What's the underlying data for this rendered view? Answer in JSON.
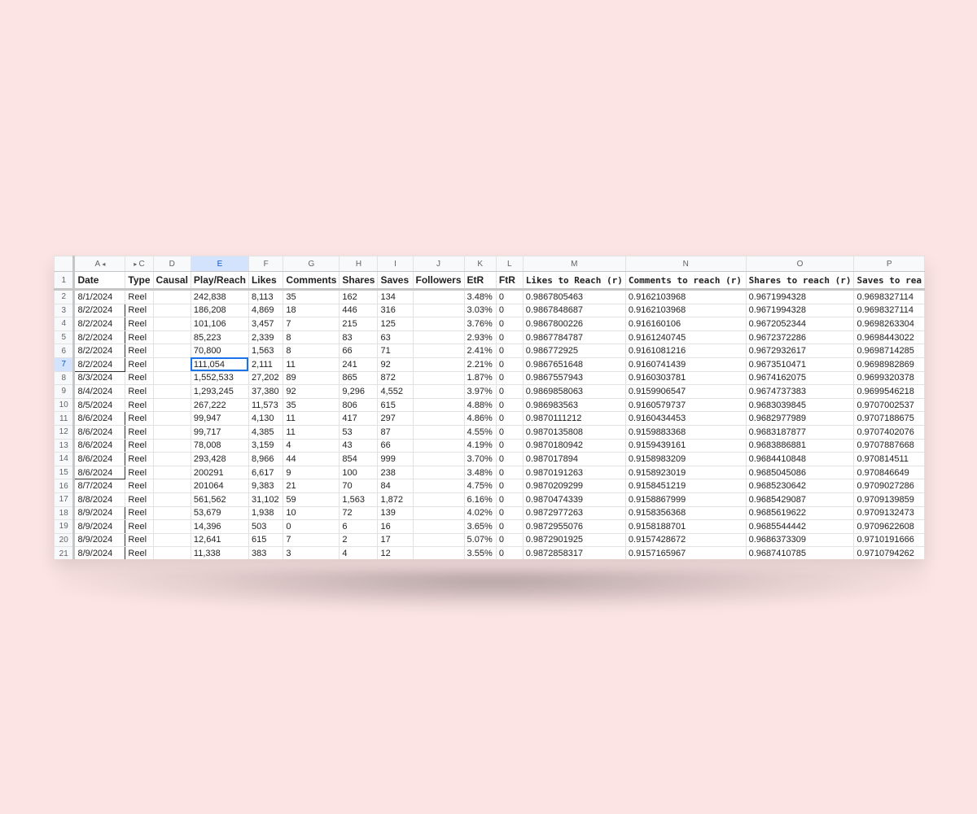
{
  "sheet": {
    "column_letters": [
      "A",
      "C",
      "D",
      "E",
      "F",
      "G",
      "H",
      "I",
      "J",
      "K",
      "L",
      "M",
      "N",
      "O",
      "P"
    ],
    "headers": [
      "Date",
      "Type",
      "Causal",
      "Play/Reach",
      "Likes",
      "Comments",
      "Shares",
      "Saves",
      "Followers",
      "EtR",
      "FtR",
      "Likes to Reach (r)",
      "Comments to reach (r)",
      "Shares to reach (r)",
      "Saves to rea"
    ],
    "selected_column": "E",
    "selected_row": "7",
    "rows": [
      {
        "num": "2",
        "cells": [
          "8/1/2024",
          "Reel",
          "",
          "242,838",
          "8,113",
          "35",
          "162",
          "134",
          "",
          "3.48%",
          "0",
          "0.9867805463",
          "0.9162103968",
          "0.9671994328",
          "0.9698327114"
        ]
      },
      {
        "num": "3",
        "cells": [
          "8/2/2024",
          "Reel",
          "",
          "186,208",
          "4,869",
          "18",
          "446",
          "316",
          "",
          "3.03%",
          "0",
          "0.9867848687",
          "0.9162103968",
          "0.9671994328",
          "0.9698327114"
        ]
      },
      {
        "num": "4",
        "cells": [
          "8/2/2024",
          "Reel",
          "",
          "101,106",
          "3,457",
          "7",
          "215",
          "125",
          "",
          "3.76%",
          "0",
          "0.9867800226",
          "0.916160106",
          "0.9672052344",
          "0.9698263304"
        ]
      },
      {
        "num": "5",
        "cells": [
          "8/2/2024",
          "Reel",
          "",
          "85,223",
          "2,339",
          "8",
          "83",
          "63",
          "",
          "2.93%",
          "0",
          "0.9867784787",
          "0.9161240745",
          "0.9672372286",
          "0.9698443022"
        ]
      },
      {
        "num": "6",
        "cells": [
          "8/2/2024",
          "Reel",
          "",
          "70,800",
          "1,563",
          "8",
          "66",
          "71",
          "",
          "2.41%",
          "0",
          "0.986772925",
          "0.9161081216",
          "0.9672932617",
          "0.9698714285"
        ]
      },
      {
        "num": "7",
        "cells": [
          "8/2/2024",
          "Reel",
          "",
          "111,054",
          "2,111",
          "11",
          "241",
          "92",
          "",
          "2.21%",
          "0",
          "0.9867651648",
          "0.9160741439",
          "0.9673510471",
          "0.9698982869"
        ]
      },
      {
        "num": "8",
        "cells": [
          "8/3/2024",
          "Reel",
          "",
          "1,552,533",
          "27,202",
          "89",
          "865",
          "872",
          "",
          "1.87%",
          "0",
          "0.9867557943",
          "0.9160303781",
          "0.9674162075",
          "0.9699320378"
        ]
      },
      {
        "num": "9",
        "cells": [
          "8/4/2024",
          "Reel",
          "",
          "1,293,245",
          "37,380",
          "92",
          "9,296",
          "4,552",
          "",
          "3.97%",
          "0",
          "0.9869858063",
          "0.9159906547",
          "0.9674737383",
          "0.9699546218"
        ]
      },
      {
        "num": "10",
        "cells": [
          "8/5/2024",
          "Reel",
          "",
          "267,222",
          "11,573",
          "35",
          "806",
          "615",
          "",
          "4.88%",
          "0",
          "0.986983563",
          "0.9160579737",
          "0.9683039845",
          "0.9707002537"
        ]
      },
      {
        "num": "11",
        "cells": [
          "8/6/2024",
          "Reel",
          "",
          "99,947",
          "4,130",
          "11",
          "417",
          "297",
          "",
          "4.86%",
          "0",
          "0.9870111212",
          "0.9160434453",
          "0.9682977989",
          "0.9707188675"
        ]
      },
      {
        "num": "12",
        "cells": [
          "8/6/2024",
          "Reel",
          "",
          "99,717",
          "4,385",
          "11",
          "53",
          "87",
          "",
          "4.55%",
          "0",
          "0.9870135808",
          "0.9159883368",
          "0.9683187877",
          "0.9707402076"
        ]
      },
      {
        "num": "13",
        "cells": [
          "8/6/2024",
          "Reel",
          "",
          "78,008",
          "3,159",
          "4",
          "43",
          "66",
          "",
          "4.19%",
          "0",
          "0.9870180942",
          "0.9159439161",
          "0.9683886881",
          "0.9707887668"
        ]
      },
      {
        "num": "14",
        "cells": [
          "8/6/2024",
          "Reel",
          "",
          "293,428",
          "8,966",
          "44",
          "854",
          "999",
          "",
          "3.70%",
          "0",
          "0.987017894",
          "0.9158983209",
          "0.9684410848",
          "0.970814511"
        ]
      },
      {
        "num": "15",
        "cells": [
          "8/6/2024",
          "Reel",
          "",
          "200291",
          "6,617",
          "9",
          "100",
          "238",
          "",
          "3.48%",
          "0",
          "0.9870191263",
          "0.9158923019",
          "0.9685045086",
          "0.970846649"
        ]
      },
      {
        "num": "16",
        "cells": [
          "8/7/2024",
          "Reel",
          "",
          "201064",
          "9,383",
          "21",
          "70",
          "84",
          "",
          "4.75%",
          "0",
          "0.9870209299",
          "0.9158451219",
          "0.9685230642",
          "0.9709027286"
        ]
      },
      {
        "num": "17",
        "cells": [
          "8/8/2024",
          "Reel",
          "",
          "561,562",
          "31,102",
          "59",
          "1,563",
          "1,872",
          "",
          "6.16%",
          "0",
          "0.9870474339",
          "0.9158867999",
          "0.9685429087",
          "0.9709139859"
        ]
      },
      {
        "num": "18",
        "cells": [
          "8/9/2024",
          "Reel",
          "",
          "53,679",
          "1,938",
          "10",
          "72",
          "139",
          "",
          "4.02%",
          "0",
          "0.9872977263",
          "0.9158356368",
          "0.9685619622",
          "0.9709132473"
        ]
      },
      {
        "num": "19",
        "cells": [
          "8/9/2024",
          "Reel",
          "",
          "14,396",
          "503",
          "0",
          "6",
          "16",
          "",
          "3.65%",
          "0",
          "0.9872955076",
          "0.9158188701",
          "0.9685544442",
          "0.9709622608"
        ]
      },
      {
        "num": "20",
        "cells": [
          "8/9/2024",
          "Reel",
          "",
          "12,641",
          "615",
          "7",
          "2",
          "17",
          "",
          "5.07%",
          "0",
          "0.9872901925",
          "0.9157428672",
          "0.9686373309",
          "0.9710191666"
        ]
      },
      {
        "num": "21",
        "cells": [
          "8/9/2024",
          "Reel",
          "",
          "11,338",
          "383",
          "3",
          "4",
          "12",
          "",
          "3.55%",
          "0",
          "0.9872858317",
          "0.9157165967",
          "0.9687410785",
          "0.9710794262"
        ]
      }
    ]
  },
  "colors": {
    "background": "#fce4e4",
    "selection_blue": "#1a73e8",
    "header_highlight": "#d3e3fd"
  }
}
